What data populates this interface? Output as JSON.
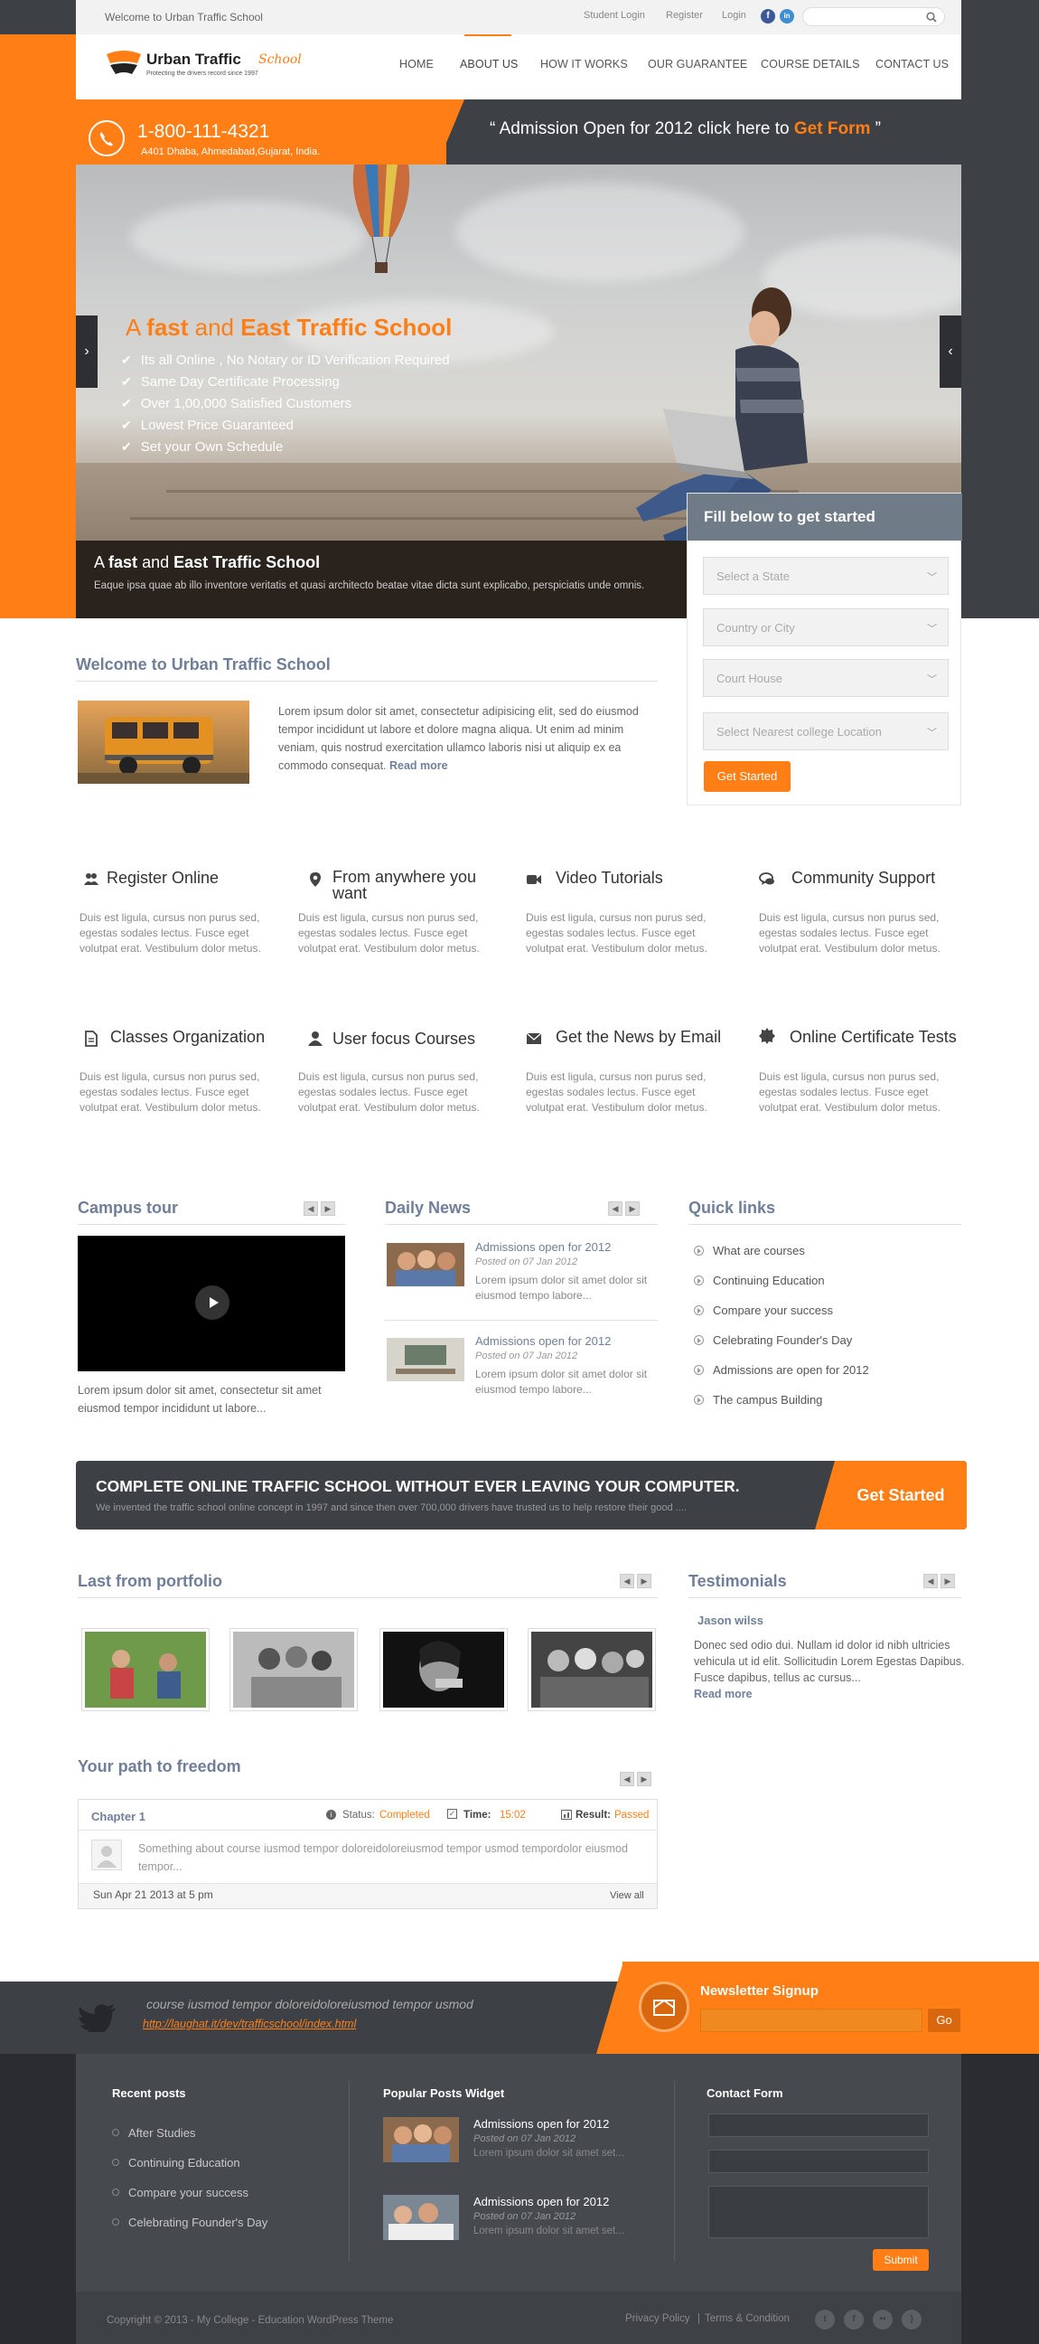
{
  "topbar": {
    "welcome": "Welcome to Urban Traffic School",
    "links": [
      "Student Login",
      "Register",
      "Login"
    ],
    "social": [
      "f",
      "in"
    ]
  },
  "brand": {
    "name": "Urban Traffic",
    "name_accent": "School",
    "tagline": "Protecting the drivers record since 1997"
  },
  "nav": [
    "HOME",
    "ABOUT US",
    "HOW IT WORKS",
    "OUR GUARANTEE",
    "COURSE DETAILS",
    "CONTACT US"
  ],
  "nav_active": "ABOUT US",
  "contact": {
    "phone": "1-800-111-4321",
    "address": "A401  Dhaba, Ahmedabad,Gujarat, India."
  },
  "admission": {
    "open_quote": "“",
    "text": "Admission Open for 2012 click here to",
    "link": "Get Form",
    "close_quote": "”"
  },
  "slider": {
    "headline_a": "A",
    "headline_fast": "fast",
    "headline_and": "and",
    "headline_rest": "East Traffic School",
    "bullets": [
      "Its all Online , No Notary or ID Verification Required",
      "Same Day Certificate Processing",
      "Over 1,00,000 Satisfied Customers",
      "Lowest Price Guaranteed",
      "Set your Own Schedule"
    ],
    "caption_a": "A",
    "caption_fast": "fast",
    "caption_and": "and",
    "caption_rest": "East Traffic School",
    "caption_text": "Eaque ipsa quae ab illo inventore veritatis et quasi architecto beatae vitae dicta sunt explicabo, perspiciatis unde omnis.",
    "prev": "›",
    "next": "‹"
  },
  "form": {
    "title": "Fill below to get started",
    "selects": [
      "Select a State",
      "Country or City",
      "Court House",
      "Select Nearest college Location"
    ],
    "button": "Get Started"
  },
  "welcome": {
    "title": "Welcome to Urban Traffic School",
    "text": "Lorem ipsum dolor sit amet, consectetur adipisicing elit, sed do eiusmod tempor incididunt ut labore et dolore magna aliqua. Ut enim ad minim veniam, quis nostrud exercitation ullamco laboris nisi ut aliquip ex ea commodo consequat.",
    "read_more": "Read more"
  },
  "features": [
    {
      "title": "Register Online",
      "icon": "users-icon",
      "text": "Duis est ligula, cursus non purus sed, egestas sodales lectus. Fusce eget volutpat erat. Vestibulum dolor metus."
    },
    {
      "title": "From anywhere you want",
      "icon": "map-marker-icon",
      "text": "Duis est ligula, cursus non purus sed, egestas sodales lectus. Fusce eget volutpat erat. Vestibulum dolor metus."
    },
    {
      "title": "Video Tutorials",
      "icon": "video-camera-icon",
      "text": "Duis est ligula, cursus non purus sed, egestas sodales lectus. Fusce eget volutpat erat. Vestibulum dolor metus."
    },
    {
      "title": "Community Support",
      "icon": "comments-icon",
      "text": "Duis est ligula, cursus non purus sed, egestas sodales lectus. Fusce eget volutpat erat. Vestibulum dolor metus."
    },
    {
      "title": "Classes Organization",
      "icon": "file-icon",
      "text": "Duis est ligula, cursus non purus sed, egestas sodales lectus. Fusce eget volutpat erat. Vestibulum dolor metus."
    },
    {
      "title": "User focus Courses",
      "icon": "user-icon",
      "text": "Duis est ligula, cursus non purus sed, egestas sodales lectus. Fusce eget volutpat erat. Vestibulum dolor metus."
    },
    {
      "title": "Get the News by Email",
      "icon": "envelope-icon",
      "text": "Duis est ligula, cursus non purus sed, egestas sodales lectus. Fusce eget volutpat erat. Vestibulum dolor metus."
    },
    {
      "title": "Online Certificate Tests",
      "icon": "certificate-icon",
      "text": "Duis est ligula, cursus non purus sed, egestas sodales lectus. Fusce eget volutpat erat. Vestibulum dolor metus."
    }
  ],
  "campus": {
    "title": "Campus tour",
    "text": "Lorem ipsum dolor sit amet, consectetur sit amet eiusmod tempor incididunt ut labore..."
  },
  "news": {
    "title": "Daily News",
    "items": [
      {
        "title": "Admissions open for 2012",
        "date": "Posted on 07 Jan 2012",
        "text": "Lorem ipsum dolor sit amet dolor sit eiusmod tempo labore..."
      },
      {
        "title": "Admissions open for 2012",
        "date": "Posted on 07 Jan 2012",
        "text": "Lorem ipsum dolor sit amet dolor sit eiusmod tempo labore..."
      }
    ]
  },
  "quicklinks": {
    "title": "Quick links",
    "items": [
      "What are courses",
      "Continuing Education",
      "Compare your success",
      "Celebrating Founder's Day",
      "Admissions are open for 2012",
      "The campus Building"
    ]
  },
  "banner": {
    "title": "COMPLETE ONLINE TRAFFIC SCHOOL WITHOUT EVER LEAVING YOUR COMPUTER.",
    "text": "We invented the traffic school online concept in 1997 and since then over 700,000 drivers have trusted us to help restore their good ....",
    "button": "Get Started"
  },
  "portfolio": {
    "title": "Last from portfolio"
  },
  "testimonials": {
    "title": "Testimonials",
    "name": "Jason wilss",
    "text": "Donec sed odio dui. Nullam id dolor id nibh ultricies vehicula ut id elit. Sollicitudin Lorem Egestas Dapibus. Fusce dapibus, tellus ac cursus...",
    "read_more": "Read more"
  },
  "path": {
    "title": "Your path to freedom",
    "chapter": "Chapter 1",
    "status_label": "Status:",
    "status_value": "Completed",
    "time_label": "Time:",
    "time_value": "15:02",
    "result_label": "Result:",
    "result_value": "Passed",
    "text": "Something about course iusmod tempor doloreidoloreiusmod tempor usmod tempordolor eiusmod tempor...",
    "date": "Sun Apr 21 2013 at 5 pm",
    "view_all": "View all"
  },
  "tweet": {
    "text": "course iusmod tempor doloreidoloreiusmod tempor usmod",
    "link": "http://laughat.it/dev/trafficschool/index.html"
  },
  "newsletter": {
    "title": "Newsletter Signup",
    "button": "Go"
  },
  "footer": {
    "recent_title": "Recent posts",
    "recent": [
      "After Studies",
      "Continuing Education",
      "Compare your success",
      "Celebrating Founder's Day"
    ],
    "popular_title": "Popular Posts Widget",
    "popular": [
      {
        "title": "Admissions open for 2012",
        "date": "Posted on 07 Jan 2012",
        "text": "Lorem ipsum dolor sit amet set..."
      },
      {
        "title": "Admissions open for 2012",
        "date": "Posted on 07 Jan 2012",
        "text": "Lorem ipsum dolor sit amet set..."
      }
    ],
    "contact_title": "Contact Form",
    "submit": "Submit",
    "copyright": "Copyright © 2013 - My College - Education WordPress Theme",
    "privacy": "Privacy Policy",
    "sep": "|",
    "terms": "Terms & Condition"
  },
  "colors": {
    "accent": "#ff7e16",
    "dark": "#3d4045",
    "title_blue": "#6f7f99"
  }
}
